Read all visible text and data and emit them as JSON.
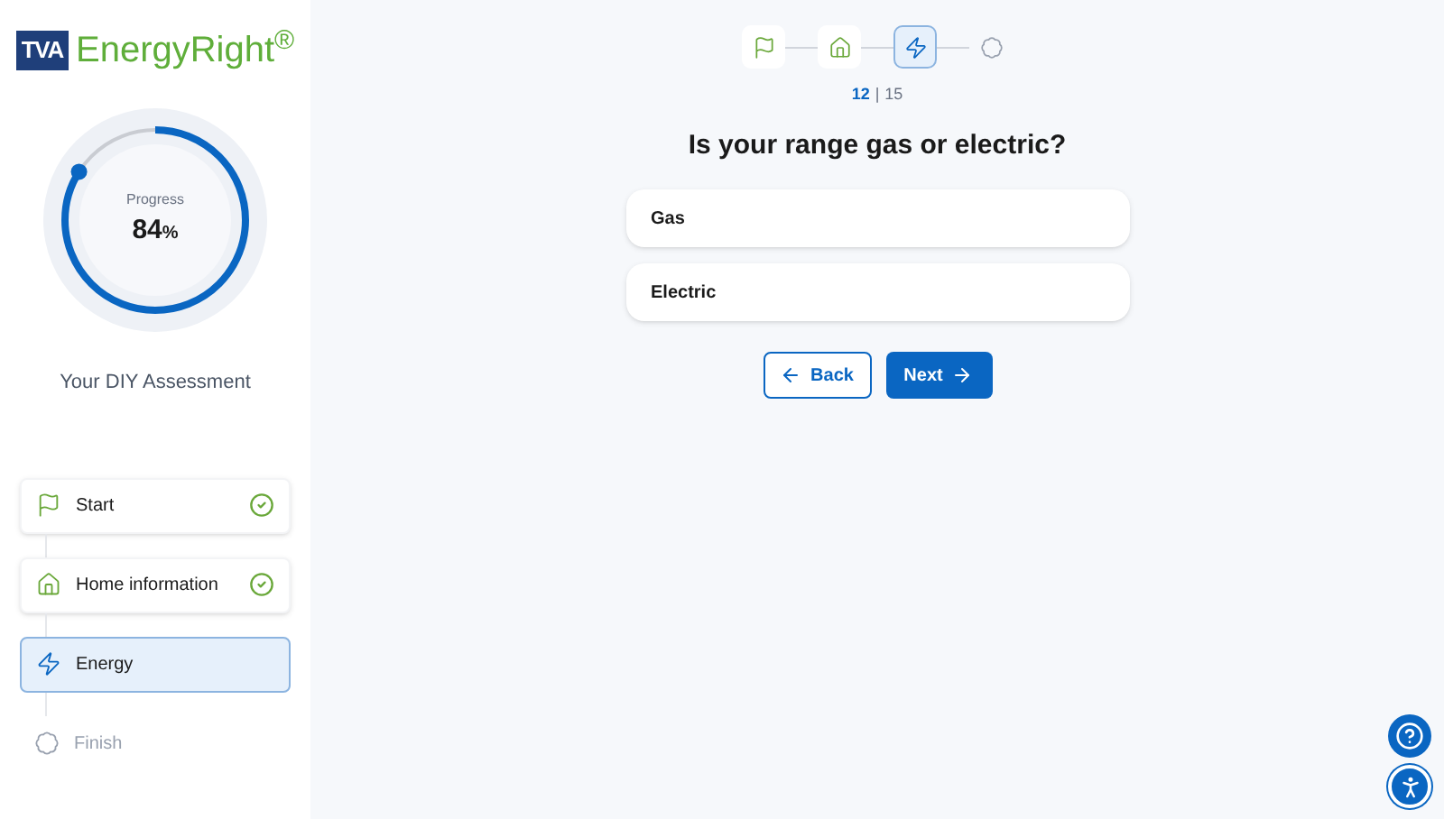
{
  "logo": {
    "badge": "TVA",
    "name": "EnergyRight$^{®}$"
  },
  "progress": {
    "label": "Progress",
    "value": "84",
    "unit": "%",
    "level": 0.84
  },
  "sidebar": {
    "title": "Your DIY Assessment",
    "steps": [
      {
        "label": "Start",
        "kind": "flag",
        "done": true,
        "selected": false
      },
      {
        "label": "Home information",
        "kind": "home",
        "done": true,
        "selected": false
      },
      {
        "label": "Energy",
        "kind": "energy",
        "done": false,
        "selected": true
      },
      {
        "label": "Finish",
        "kind": "finish",
        "done": false,
        "selected": false
      }
    ]
  },
  "stepper": [
    {
      "kind": "flag",
      "done": true,
      "selected": false
    },
    {
      "kind": "home",
      "done": true,
      "selected": false
    },
    {
      "kind": "energy",
      "done": false,
      "selected": true
    },
    {
      "kind": "finish",
      "done": false,
      "selected": false
    }
  ],
  "counter": {
    "current": "12",
    "separator": "|",
    "total": "15"
  },
  "question": "Is your range gas or electric?",
  "options": [
    {
      "label": "Gas",
      "selected": false
    },
    {
      "label": "Electric",
      "selected": false
    }
  ],
  "buttons": {
    "back": "Back",
    "next": "Next"
  }
}
